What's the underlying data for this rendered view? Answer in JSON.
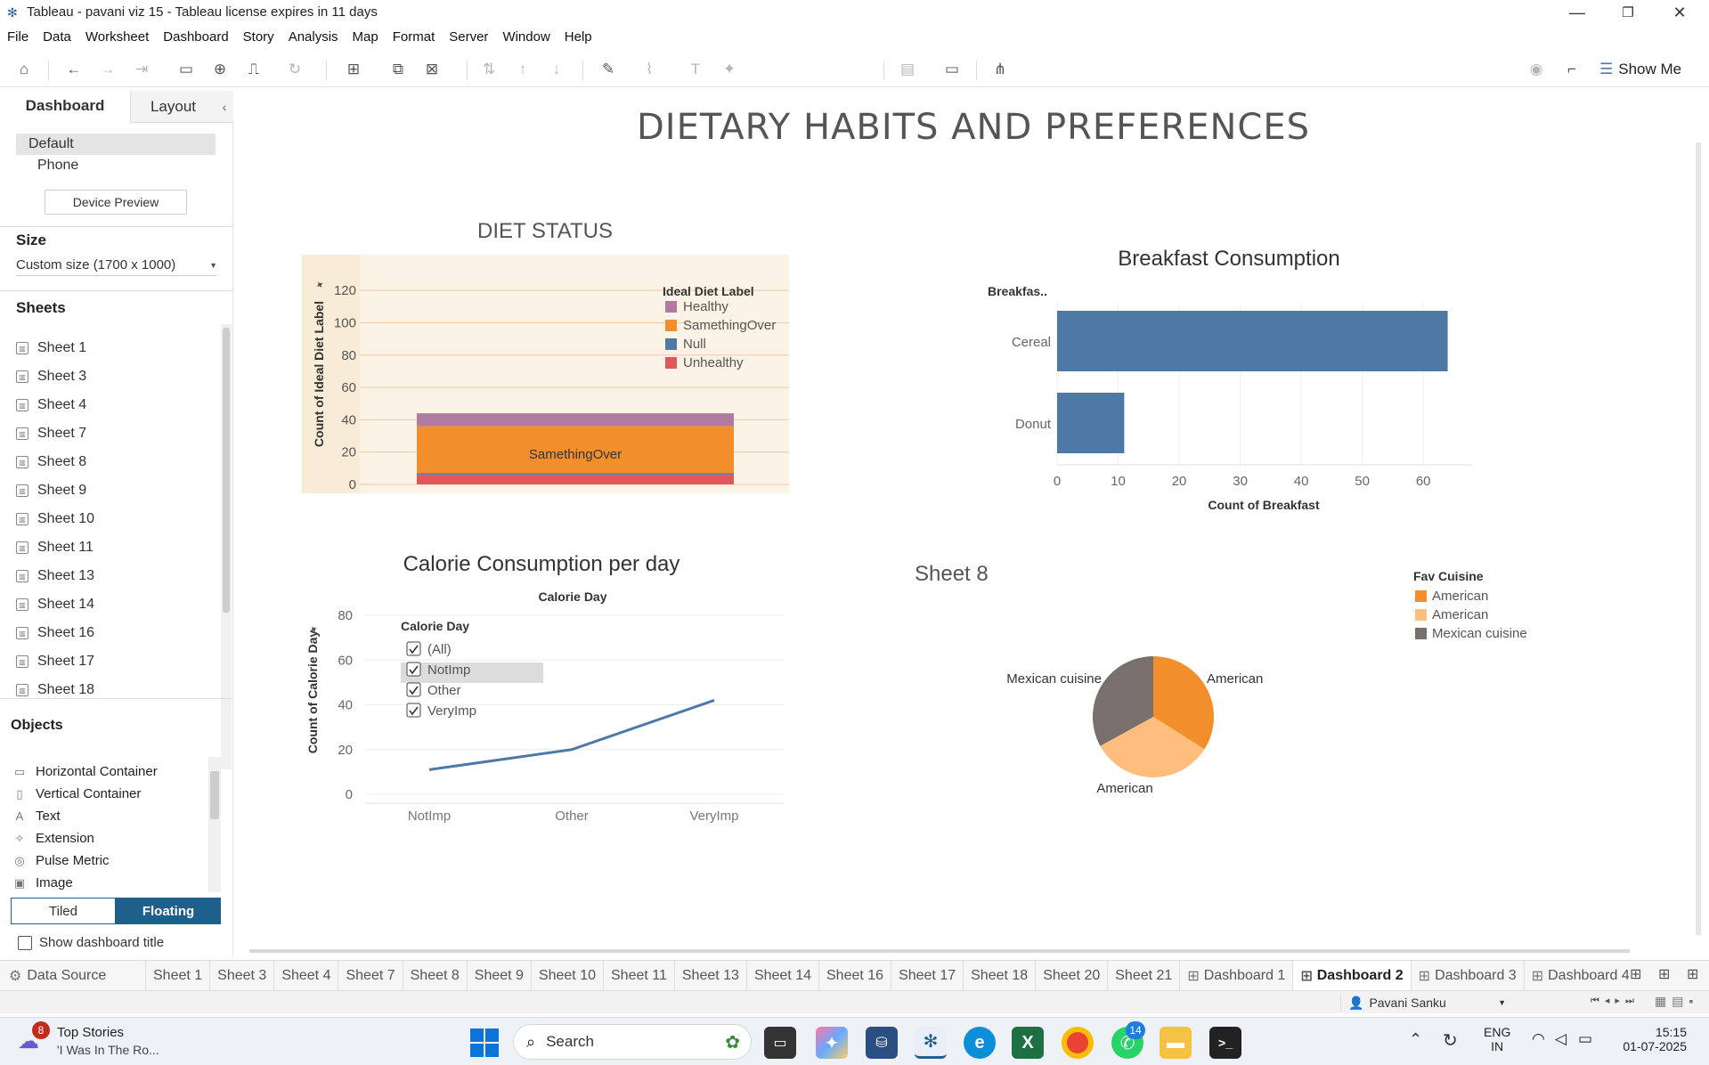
{
  "window": {
    "title": "Tableau - pavani viz 15 - Tableau license expires in 11 days",
    "minimize": "—",
    "restore": "❐",
    "close": "✕"
  },
  "menu": [
    "File",
    "Data",
    "Worksheet",
    "Dashboard",
    "Story",
    "Analysis",
    "Map",
    "Format",
    "Server",
    "Window",
    "Help"
  ],
  "toolbar": {
    "show_me": "Show Me"
  },
  "left_panel": {
    "tabs": [
      "Dashboard",
      "Layout"
    ],
    "device_default": "Default",
    "device_phone": "Phone",
    "device_preview": "Device Preview",
    "size_heading": "Size",
    "size_value": "Custom size (1700 x 1000)",
    "sheets_heading": "Sheets",
    "sheets": [
      "Sheet 1",
      "Sheet 3",
      "Sheet 4",
      "Sheet 7",
      "Sheet 8",
      "Sheet 9",
      "Sheet 10",
      "Sheet 11",
      "Sheet 13",
      "Sheet 14",
      "Sheet 16",
      "Sheet 17",
      "Sheet 18"
    ],
    "objects_heading": "Objects",
    "objects": [
      {
        "label": "Horizontal Container",
        "icon": "▭"
      },
      {
        "label": "Vertical Container",
        "icon": "▯"
      },
      {
        "label": "Text",
        "icon": "A"
      },
      {
        "label": "Extension",
        "icon": "✧"
      },
      {
        "label": "Pulse Metric",
        "icon": "◎"
      },
      {
        "label": "Image",
        "icon": "▣"
      }
    ],
    "tiled": "Tiled",
    "floating": "Floating",
    "show_title": "Show dashboard title"
  },
  "dashboard": {
    "title": "DIETARY HABITS AND PREFERENCES",
    "diet_status": {
      "title": "DIET STATUS",
      "y_label": "Count of Ideal Diet Label",
      "y_ticks": [
        "120",
        "100",
        "80",
        "60",
        "40",
        "20",
        "0"
      ],
      "legend_title": "Ideal Diet Label",
      "legend": [
        "Healthy",
        "SamethingOver",
        "Null",
        "Unhealthy"
      ],
      "bar_label": "SamethingOver"
    },
    "breakfast": {
      "title": "Breakfast Consumption",
      "axis_header": "Breakfas..",
      "x_label": "Count of Breakfast",
      "x_ticks": [
        "0",
        "10",
        "20",
        "30",
        "40",
        "50",
        "60"
      ]
    },
    "calorie": {
      "title": "Calorie Consumption per day",
      "column_header": "Calorie Day",
      "y_label": "Count of Calorie Day",
      "y_ticks": [
        "80",
        "60",
        "40",
        "20",
        "0"
      ],
      "filter_title": "Calorie Day",
      "filter_items": [
        "(All)",
        "NotImp",
        "Other",
        "VeryImp"
      ]
    },
    "pie": {
      "title": "Sheet 8",
      "legend_title": "Fav Cuisine",
      "legend": [
        "American",
        "American",
        "Mexican cuisine"
      ],
      "labels": [
        "Mexican cuisine",
        "American",
        "American"
      ]
    }
  },
  "chart_data": [
    {
      "type": "bar",
      "title": "DIET STATUS",
      "ylabel": "Count of Ideal Diet Label",
      "ylim": [
        0,
        130
      ],
      "categories": [
        ""
      ],
      "stacked": true,
      "series": [
        {
          "name": "Unhealthy",
          "values": [
            6
          ],
          "color": "#e15759"
        },
        {
          "name": "Null",
          "values": [
            1
          ],
          "color": "#4e79a7"
        },
        {
          "name": "SamethingOver",
          "values": [
            29
          ],
          "color": "#f28e2b"
        },
        {
          "name": "Healthy",
          "values": [
            8
          ],
          "color": "#b07aa1"
        }
      ]
    },
    {
      "type": "bar",
      "orientation": "horizontal",
      "title": "Breakfast Consumption",
      "xlabel": "Count of Breakfast",
      "xlim": [
        0,
        68
      ],
      "categories": [
        "Cereal",
        "Donut"
      ],
      "values": [
        64,
        11
      ],
      "color": "#4e79a7"
    },
    {
      "type": "line",
      "title": "Calorie Consumption per day",
      "ylabel": "Count of Calorie Day",
      "ylim": [
        0,
        80
      ],
      "categories": [
        "NotImp",
        "Other",
        "VeryImp"
      ],
      "values": [
        11,
        20,
        42
      ],
      "color": "#4e79a7"
    },
    {
      "type": "pie",
      "title": "Sheet 8",
      "categories": [
        "American",
        "American",
        "Mexican cuisine"
      ],
      "values": [
        34,
        33,
        33
      ],
      "colors": [
        "#f28e2b",
        "#ffbe7d",
        "#79706e"
      ]
    }
  ],
  "bottom_tabs": [
    "Data Source",
    "Sheet 1",
    "Sheet 3",
    "Sheet 4",
    "Sheet 7",
    "Sheet 8",
    "Sheet 9",
    "Sheet 10",
    "Sheet 11",
    "Sheet 13",
    "Sheet 14",
    "Sheet 16",
    "Sheet 17",
    "Sheet 18",
    "Sheet 20",
    "Sheet 21",
    "Dashboard 1",
    "Dashboard 2",
    "Dashboard 3",
    "Dashboard 4"
  ],
  "active_tab": "Dashboard 2",
  "status": {
    "user": "Pavani Sanku"
  },
  "taskbar": {
    "news_title": "Top Stories",
    "news_sub": "'I Was In The Ro...",
    "news_badge": "8",
    "search": "Search",
    "whatsapp_badge": "14",
    "lang1": "ENG",
    "lang2": "IN",
    "time": "15:15",
    "date": "01-07-2025"
  }
}
